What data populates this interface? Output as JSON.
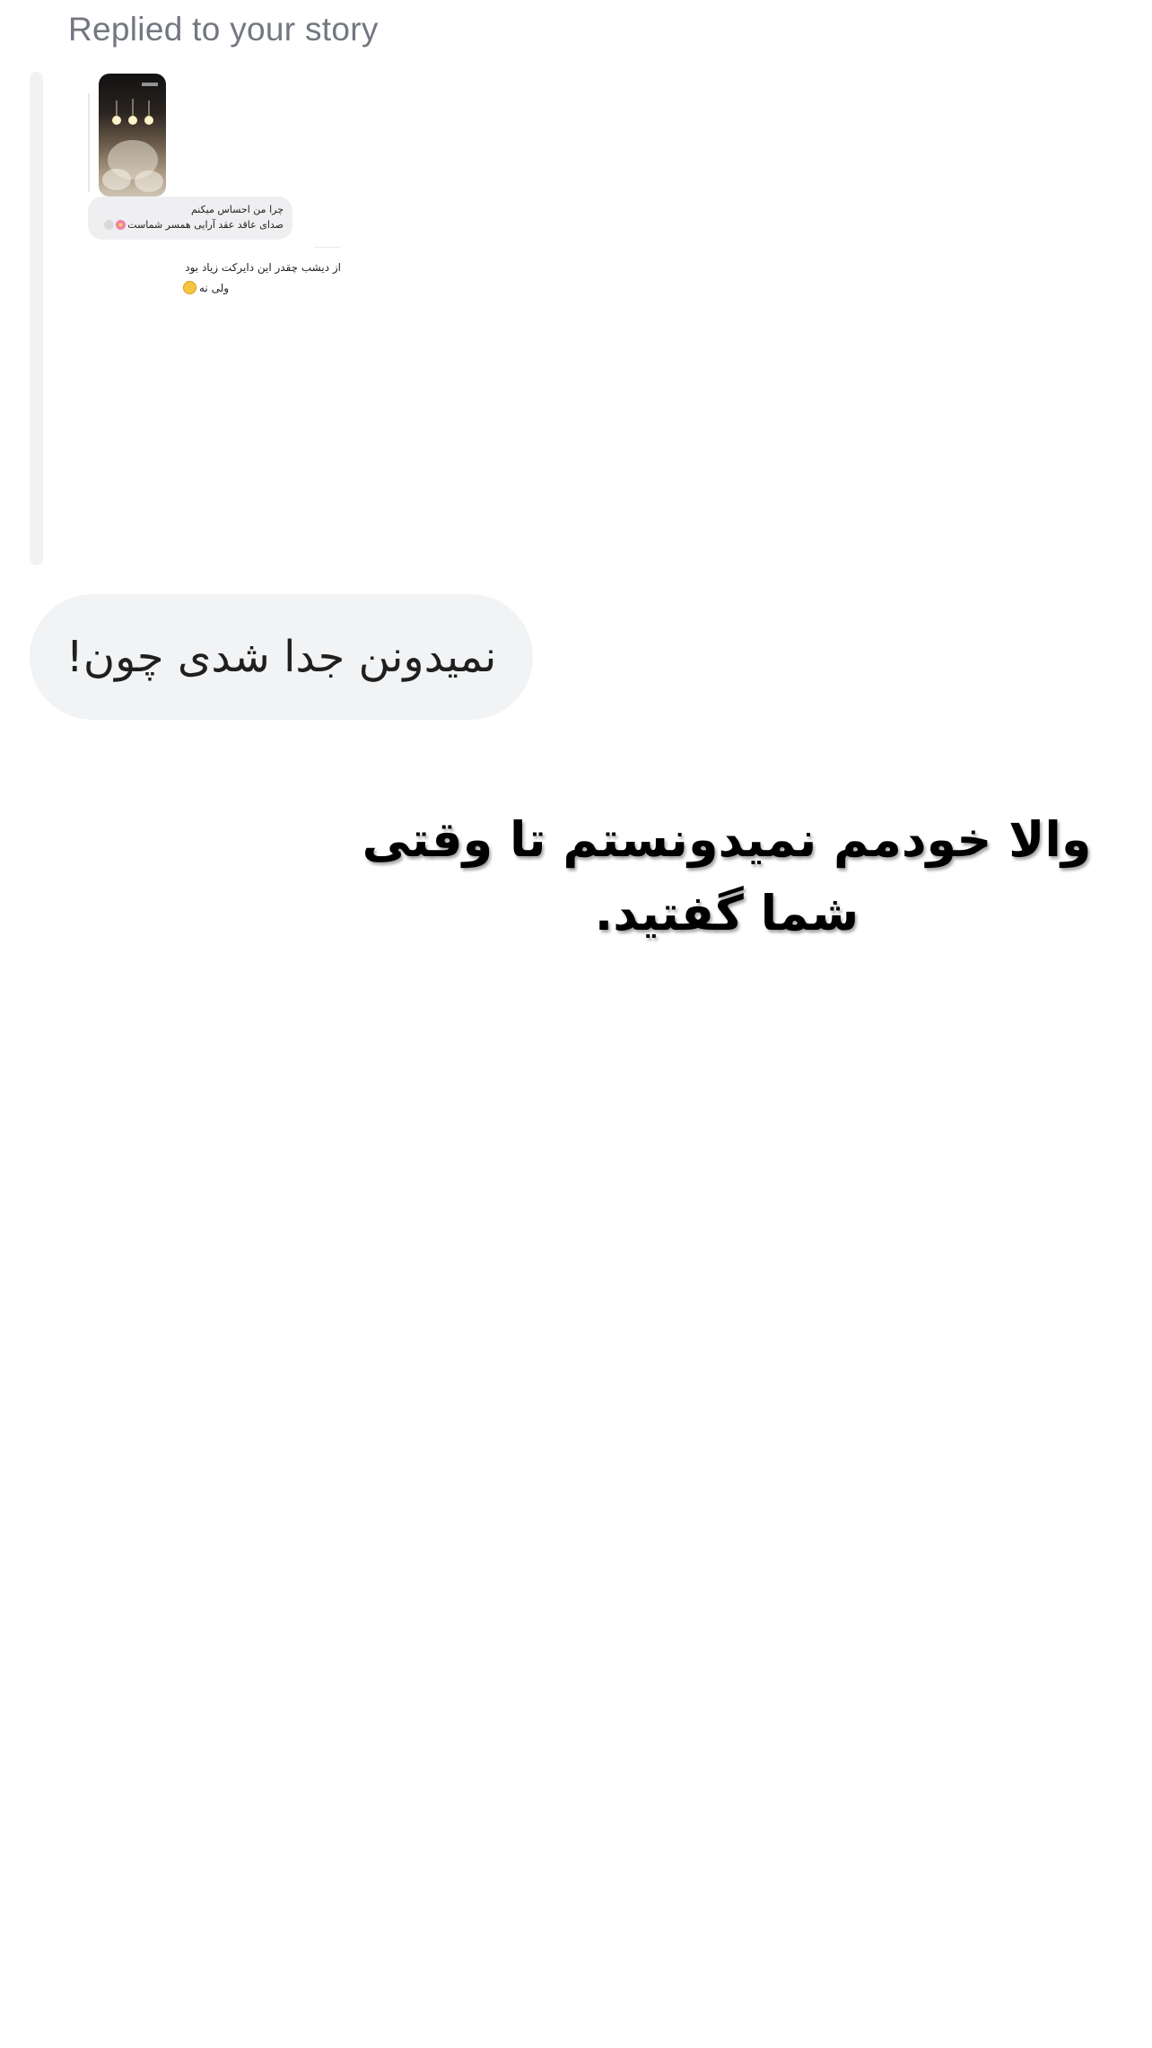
{
  "reply_header": {
    "label": "Replied to your story"
  },
  "story_preview": {
    "reply_line1": "چرا من احساس میکنم",
    "reply_line2": "صدای عاقد عقد آرایی همسر شماست",
    "dm_line1": "از دیشب چقدر این دایرکت زیاد بود",
    "dm_line2": "ولی نه"
  },
  "message": {
    "text": "نمیدونن جدا شدی چون!",
    "bubble_color": "#f2f3f5"
  },
  "caption": {
    "text": "والا خودمم نمیدونستم تا وقتی شما گفتید."
  },
  "icons": {
    "heart": "heart-icon",
    "flower": "flower-icon",
    "smile": "smile-emoji-icon"
  }
}
